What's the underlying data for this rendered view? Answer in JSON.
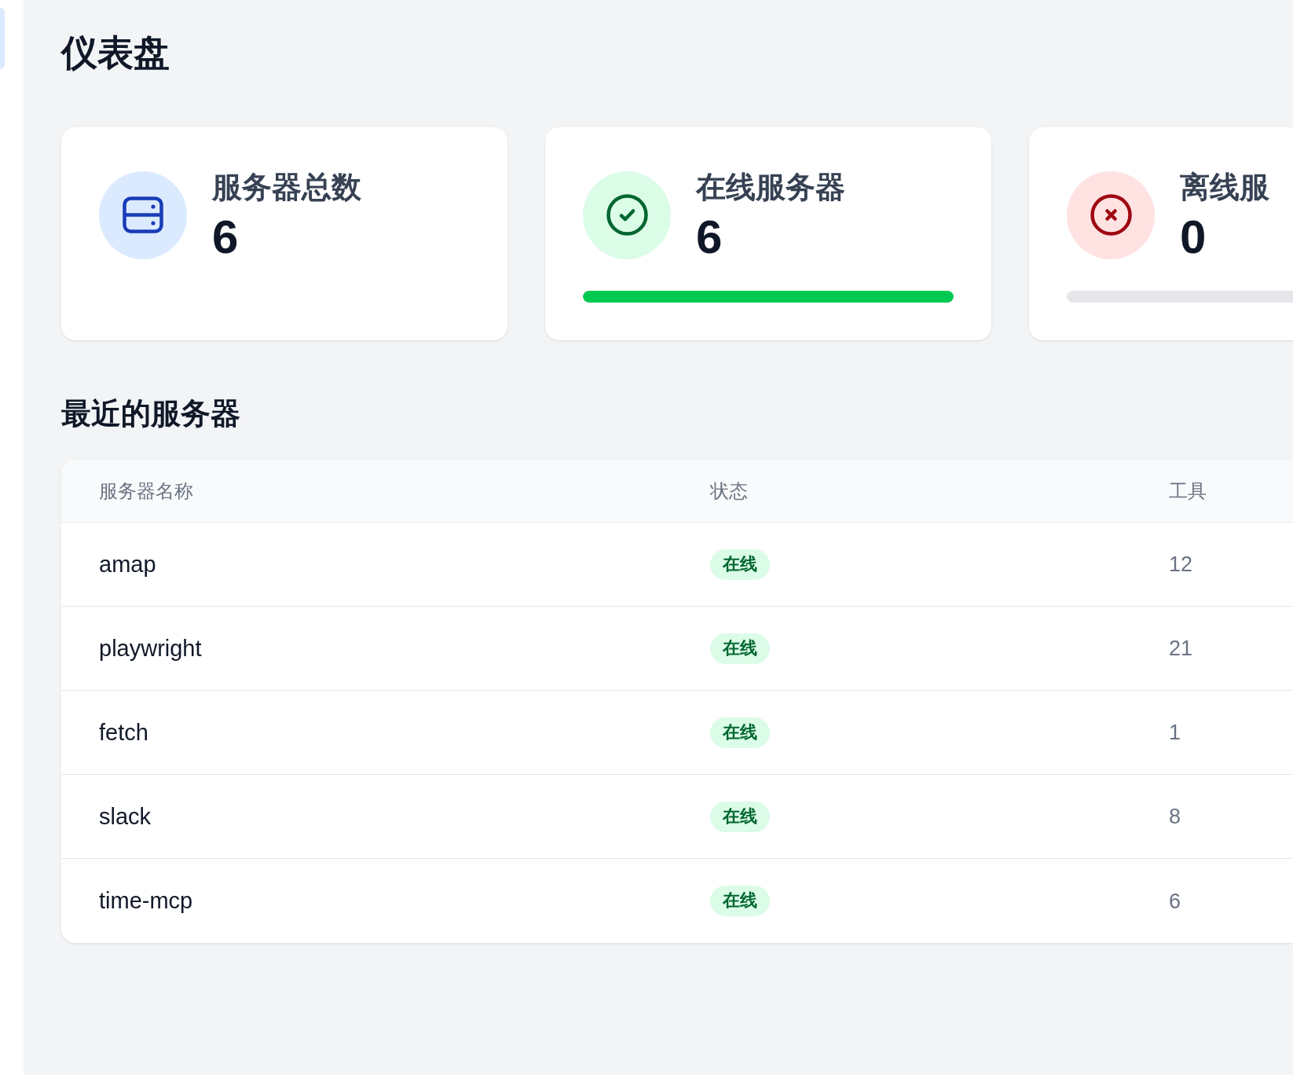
{
  "sidebar": {
    "items": [
      {
        "selected": true
      }
    ]
  },
  "page_title": "仪表盘",
  "stat_cards": [
    {
      "kind": "total",
      "label": "服务器总数",
      "value": "6"
    },
    {
      "kind": "online",
      "label": "在线服务器",
      "value": "6",
      "level": 1
    },
    {
      "kind": "offline",
      "label": "离线服",
      "value": "0",
      "level": 0
    }
  ],
  "recent_servers": {
    "title": "最近的服务器",
    "columns": [
      "服务器名称",
      "状态",
      "工具"
    ],
    "rows": [
      {
        "name": "amap",
        "status": "在线",
        "online": true,
        "tools": "12"
      },
      {
        "name": "playwright",
        "status": "在线",
        "online": true,
        "tools": "21"
      },
      {
        "name": "fetch",
        "status": "在线",
        "online": true,
        "tools": "1"
      },
      {
        "name": "slack",
        "status": "在线",
        "online": true,
        "tools": "8"
      },
      {
        "name": "time-mcp",
        "status": "在线",
        "online": true,
        "tools": "6"
      }
    ]
  }
}
